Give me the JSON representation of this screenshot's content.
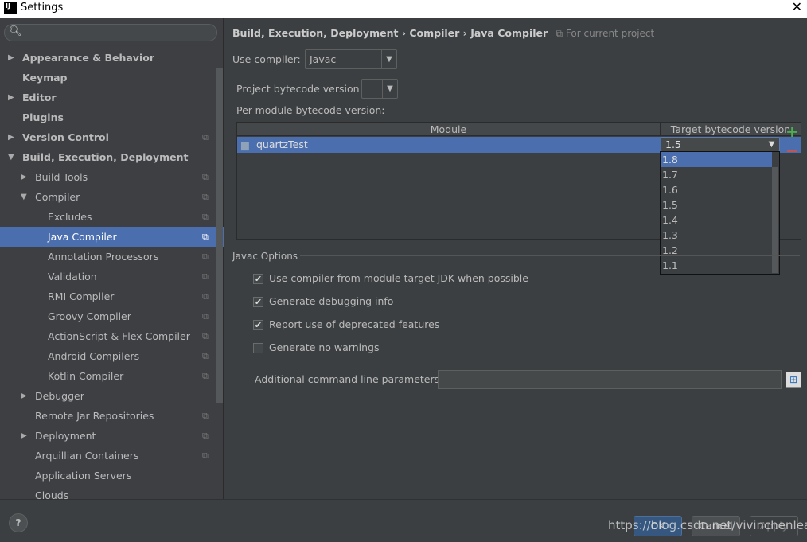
{
  "window": {
    "title": "Settings",
    "logo": "IJ"
  },
  "sidebar": {
    "items": [
      {
        "label": "Appearance & Behavior",
        "level": 0,
        "arrow": "right",
        "bold": true
      },
      {
        "label": "Keymap",
        "level": 0,
        "bold": true
      },
      {
        "label": "Editor",
        "level": 0,
        "arrow": "right",
        "bold": true
      },
      {
        "label": "Plugins",
        "level": 0,
        "bold": true
      },
      {
        "label": "Version Control",
        "level": 0,
        "arrow": "right",
        "bold": true,
        "project": true
      },
      {
        "label": "Build, Execution, Deployment",
        "level": 0,
        "arrow": "down",
        "bold": true
      },
      {
        "label": "Build Tools",
        "level": 1,
        "arrow": "right",
        "project": true
      },
      {
        "label": "Compiler",
        "level": 1,
        "arrow": "down",
        "project": true
      },
      {
        "label": "Excludes",
        "level": 2,
        "project": true
      },
      {
        "label": "Java Compiler",
        "level": 2,
        "project": true,
        "selected": true
      },
      {
        "label": "Annotation Processors",
        "level": 2,
        "project": true
      },
      {
        "label": "Validation",
        "level": 2,
        "project": true
      },
      {
        "label": "RMI Compiler",
        "level": 2,
        "project": true
      },
      {
        "label": "Groovy Compiler",
        "level": 2,
        "project": true
      },
      {
        "label": "ActionScript & Flex Compiler",
        "level": 2,
        "project": true
      },
      {
        "label": "Android Compilers",
        "level": 2,
        "project": true
      },
      {
        "label": "Kotlin Compiler",
        "level": 2,
        "project": true
      },
      {
        "label": "Debugger",
        "level": 1,
        "arrow": "right"
      },
      {
        "label": "Remote Jar Repositories",
        "level": 1,
        "project": true
      },
      {
        "label": "Deployment",
        "level": 1,
        "arrow": "right",
        "project": true
      },
      {
        "label": "Arquillian Containers",
        "level": 1,
        "project": true
      },
      {
        "label": "Application Servers",
        "level": 1
      },
      {
        "label": "Clouds",
        "level": 1
      }
    ]
  },
  "breadcrumb": {
    "parts": [
      "Build, Execution, Deployment",
      "Compiler",
      "Java Compiler"
    ],
    "sep": "›",
    "scope": "For current project"
  },
  "main": {
    "use_compiler_label": "Use compiler:",
    "use_compiler_value": "Javac",
    "project_bytecode_label": "Project bytecode version:",
    "project_bytecode_value": "",
    "per_module_label": "Per-module bytecode version:",
    "table": {
      "headers": [
        "Module",
        "Target bytecode version"
      ],
      "rows": [
        {
          "module": "quartzTest",
          "version": "1.5"
        }
      ]
    },
    "dropdown_options": [
      "1.8",
      "1.7",
      "1.6",
      "1.5",
      "1.4",
      "1.3",
      "1.2",
      "1.1"
    ],
    "dropdown_highlighted": "1.8",
    "javac_options_label": "Javac Options",
    "checkboxes": [
      {
        "label": "Use compiler from module target JDK when possible",
        "checked": true
      },
      {
        "label": "Generate debugging info",
        "checked": true
      },
      {
        "label": "Report use of deprecated features",
        "checked": true
      },
      {
        "label": "Generate no warnings",
        "checked": false
      }
    ],
    "additional_params_label": "Additional command line parameters:",
    "additional_params_value": ""
  },
  "buttons": {
    "ok": "OK",
    "cancel": "Cancel",
    "apply": "Apply",
    "help": "?"
  },
  "watermark": "https://blog.csdn.net/vivinchenleaf",
  "colors": {
    "selection": "#4b6eaf",
    "add": "#4caf50",
    "remove": "#c75450"
  }
}
